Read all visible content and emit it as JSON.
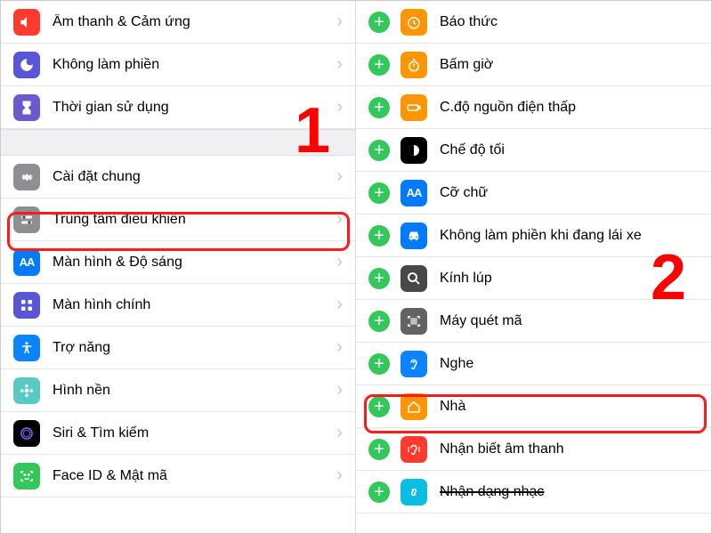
{
  "steps": {
    "one": "1",
    "two": "2"
  },
  "left": {
    "items": [
      {
        "label": "Âm thanh & Cảm ứng",
        "icon": "sound",
        "bg": "bg-red"
      },
      {
        "label": "Không làm phiền",
        "icon": "moon",
        "bg": "bg-purple"
      },
      {
        "label": "Thời gian sử dụng",
        "icon": "hourglass",
        "bg": "bg-purple2"
      },
      {
        "label": "Cài đặt chung",
        "icon": "gear",
        "bg": "bg-gray"
      },
      {
        "label": "Trung tâm điều khiển",
        "icon": "toggles",
        "bg": "bg-gray2"
      },
      {
        "label": "Màn hình & Độ sáng",
        "icon": "AA",
        "bg": "bg-blue"
      },
      {
        "label": "Màn hình chính",
        "icon": "grid",
        "bg": "bg-purple"
      },
      {
        "label": "Trợ năng",
        "icon": "person",
        "bg": "bg-blue2"
      },
      {
        "label": "Hình nền",
        "icon": "flower",
        "bg": "bg-teal"
      },
      {
        "label": "Siri & Tìm kiếm",
        "icon": "siri",
        "bg": "bg-black"
      },
      {
        "label": "Face ID & Mật mã",
        "icon": "face",
        "bg": "bg-green"
      }
    ]
  },
  "right": {
    "items": [
      {
        "label": "Báo thức",
        "icon": "clock",
        "bg": "bg-orange"
      },
      {
        "label": "Bấm giờ",
        "icon": "stopwatch",
        "bg": "bg-orange2"
      },
      {
        "label": "C.độ nguồn điện thấp",
        "icon": "battery",
        "bg": "bg-orange"
      },
      {
        "label": "Chế độ tối",
        "icon": "darkmode",
        "bg": "bg-black"
      },
      {
        "label": "Cỡ chữ",
        "icon": "AA",
        "bg": "bg-blue"
      },
      {
        "label": "Không làm phiền khi đang lái xe",
        "icon": "car",
        "bg": "bg-blue"
      },
      {
        "label": "Kính lúp",
        "icon": "magnify",
        "bg": "bg-darkgray"
      },
      {
        "label": "Máy quét mã",
        "icon": "qr",
        "bg": "bg-darkgray2"
      },
      {
        "label": "Nghe",
        "icon": "ear",
        "bg": "bg-blue2"
      },
      {
        "label": "Nhà",
        "icon": "home",
        "bg": "bg-orange"
      },
      {
        "label": "Nhận biết âm thanh",
        "icon": "soundrec",
        "bg": "bg-redplain"
      },
      {
        "label": "Nhận dạng nhạc",
        "icon": "shazam",
        "bg": "bg-cyan"
      }
    ]
  }
}
